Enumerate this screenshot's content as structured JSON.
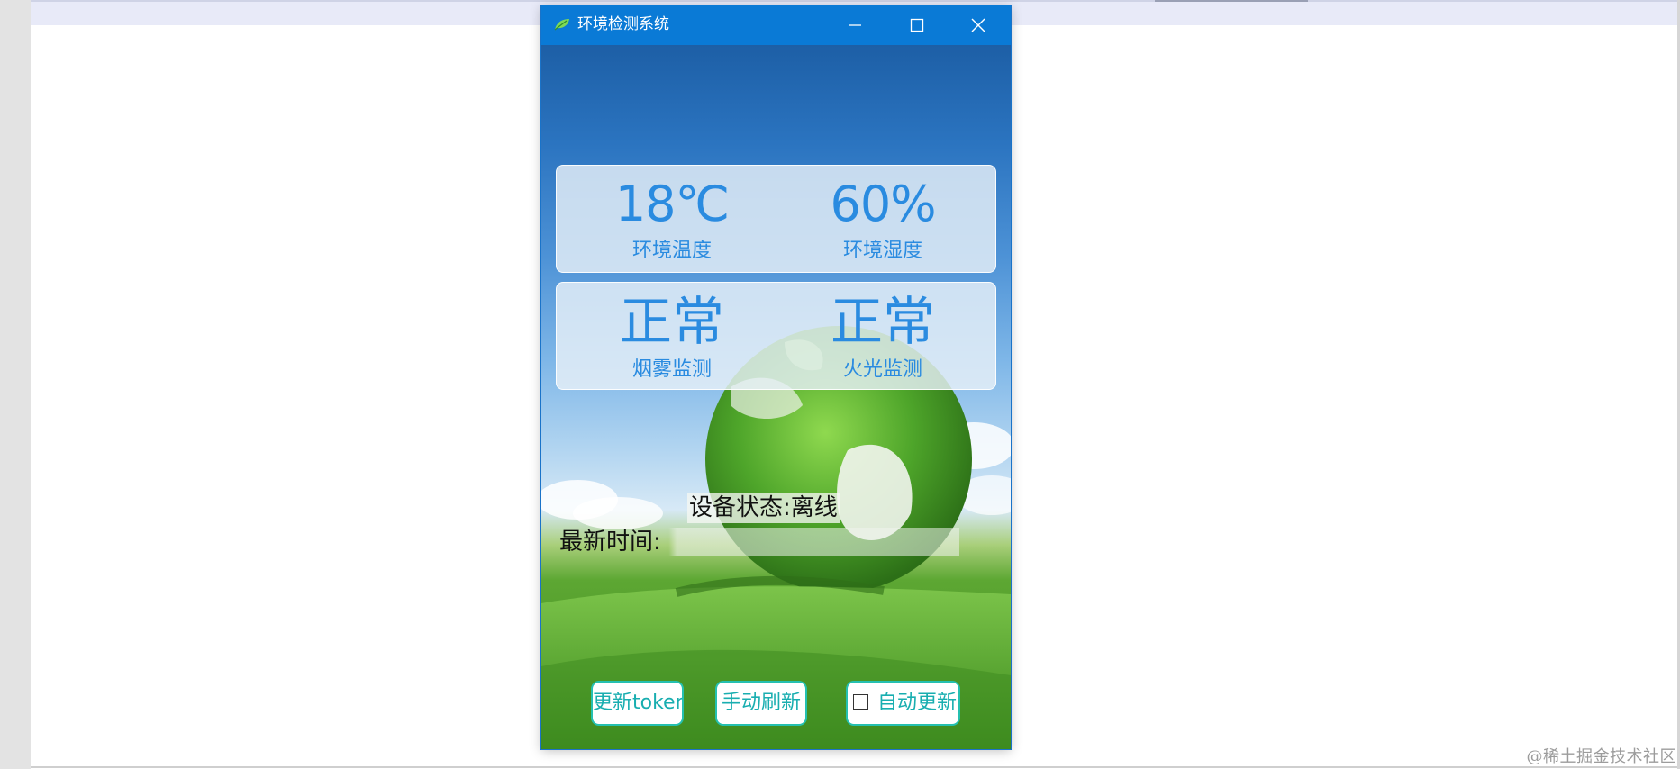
{
  "window": {
    "title": "环境检测系统",
    "icon": "leaf-icon"
  },
  "title_bar": {
    "minimize_icon": "minimize-icon",
    "maximize_icon": "maximize-icon",
    "close_icon": "close-icon"
  },
  "environment": {
    "temperature": {
      "value": "18℃",
      "label": "环境温度"
    },
    "humidity": {
      "value": "60%",
      "label": "环境湿度"
    }
  },
  "alarms": {
    "smoke": {
      "value": "正常",
      "label": "烟雾监测"
    },
    "fire": {
      "value": "正常",
      "label": "火光监测"
    }
  },
  "device": {
    "status_text": "设备状态:离线",
    "latest_time_label": "最新时间:",
    "latest_time_value": ""
  },
  "buttons": {
    "update_token": "更新token",
    "manual_refresh": "手动刷新",
    "auto_update": "自动更新",
    "auto_update_checked": false
  },
  "page": {
    "watermark": "@稀土掘金技术社区"
  },
  "colors": {
    "title_bar": "#0a7ad6",
    "metric_text": "#2a8be0",
    "button_border": "#25c0b0",
    "button_text": "#19aeb0"
  }
}
